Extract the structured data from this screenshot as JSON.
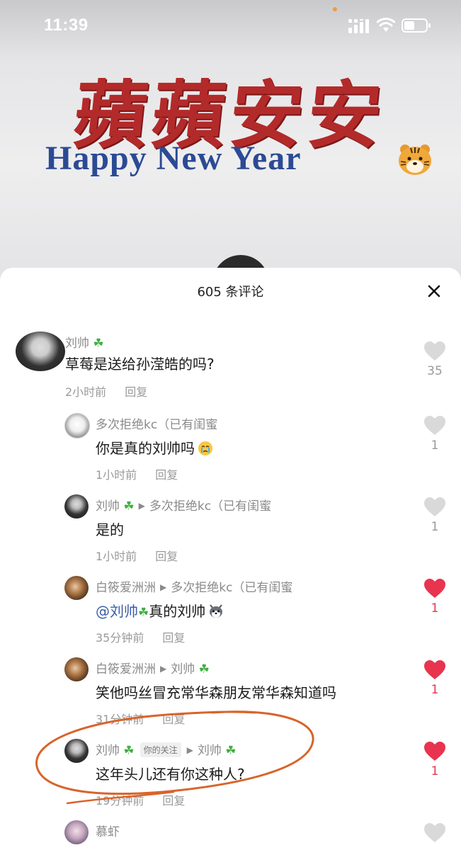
{
  "status_bar": {
    "time": "11:39"
  },
  "video": {
    "banner_title": "蘋蘋安安",
    "banner_subtitle": "Happy New Year"
  },
  "sheet": {
    "title": "605 条评论",
    "comments": [
      {
        "user": "刘帅",
        "text": "草莓是送给孙滢皓的吗?",
        "time": "2小时前",
        "reply": "回复",
        "likes": "35",
        "liked": false
      },
      {
        "user": "多次拒绝kc（已有闺蜜",
        "text": "你是真的刘帅吗",
        "time": "1小时前",
        "reply": "回复",
        "likes": "1",
        "liked": false
      },
      {
        "user": "刘帅",
        "reply_to": "多次拒绝kc（已有闺蜜",
        "text": "是的",
        "time": "1小时前",
        "reply": "回复",
        "likes": "1",
        "liked": false
      },
      {
        "user": "白筱爱洲洲",
        "reply_to": "多次拒绝kc（已有闺蜜",
        "mention": "@刘帅",
        "text": "真的刘帅",
        "time": "35分钟前",
        "reply": "回复",
        "likes": "1",
        "liked": true
      },
      {
        "user": "白筱爱洲洲",
        "reply_to": "刘帅",
        "text": "笑他吗丝冒充常华森朋友常华森知道吗",
        "time": "31分钟前",
        "reply": "回复",
        "likes": "1",
        "liked": true
      },
      {
        "user": "刘帅",
        "follow_tag": "你的关注",
        "reply_to": "刘帅",
        "text": "这年头儿还有你这种人?",
        "time": "19分钟前",
        "reply": "回复",
        "likes": "1",
        "liked": true
      },
      {
        "user": "慕虾",
        "text": "",
        "time": "",
        "reply": "",
        "likes": "",
        "liked": false
      }
    ]
  },
  "colors": {
    "like_red": "#e8344e",
    "annotation": "#d8642a",
    "banner_red": "#b32a2a",
    "banner_blue": "#2c4a94"
  }
}
